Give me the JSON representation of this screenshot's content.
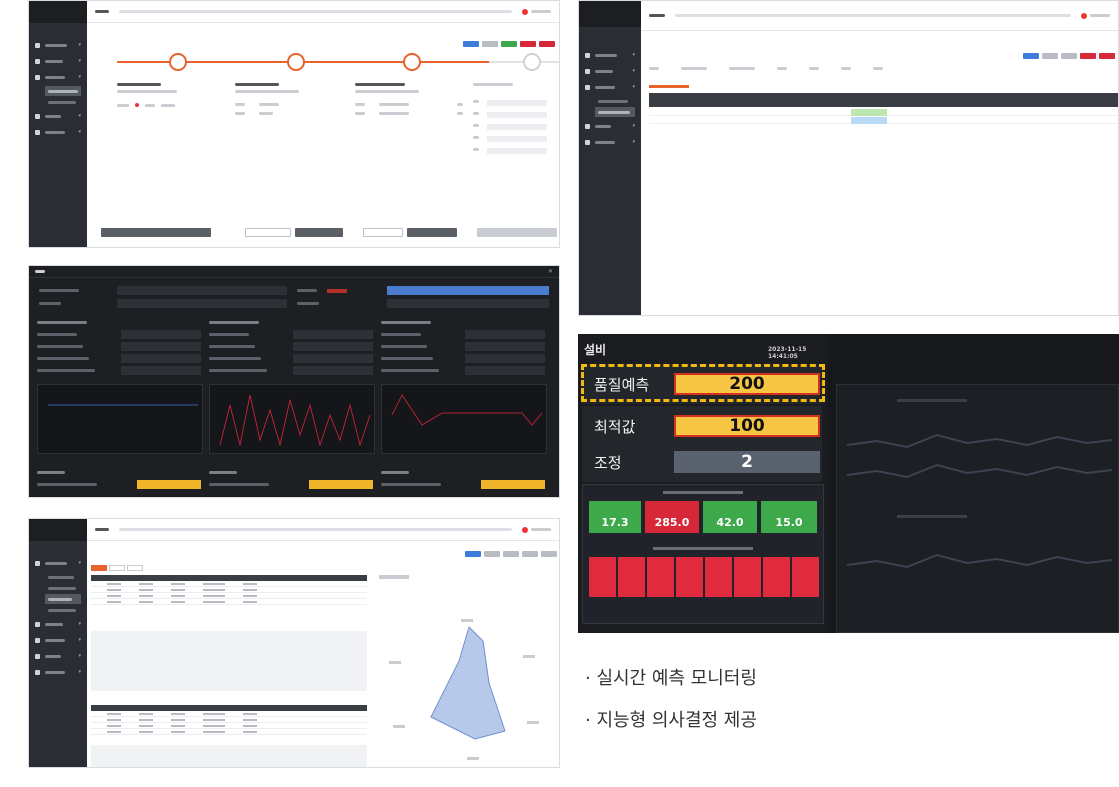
{
  "monitor": {
    "title": "설비",
    "timestamp": "2023-11-15 14:41:05",
    "rows": [
      {
        "label": "품질예측",
        "value": "200",
        "style": "yellow"
      },
      {
        "label": "최적값",
        "value": "100",
        "style": "yellow"
      },
      {
        "label": "조정",
        "value": "2",
        "style": "gray"
      }
    ],
    "tiles_green_red": [
      "17.3",
      "285.0",
      "42.0",
      "15.0"
    ],
    "tile_colors": [
      "green",
      "red",
      "green",
      "green"
    ],
    "tiles_bottom_count": 8,
    "highlight_color": "#f2b90f"
  },
  "features": [
    "· 실시간 예측 모니터링",
    "· 지능형 의사결정 제공"
  ],
  "colors": {
    "accent_orange": "#e7622c",
    "sidebar_dark": "#2a2d33",
    "value_yellow": "#f6c544",
    "tile_green": "#3ea94a",
    "tile_red": "#d7283a"
  },
  "icons": {
    "user": "user-icon",
    "nav": "menu-icon"
  }
}
